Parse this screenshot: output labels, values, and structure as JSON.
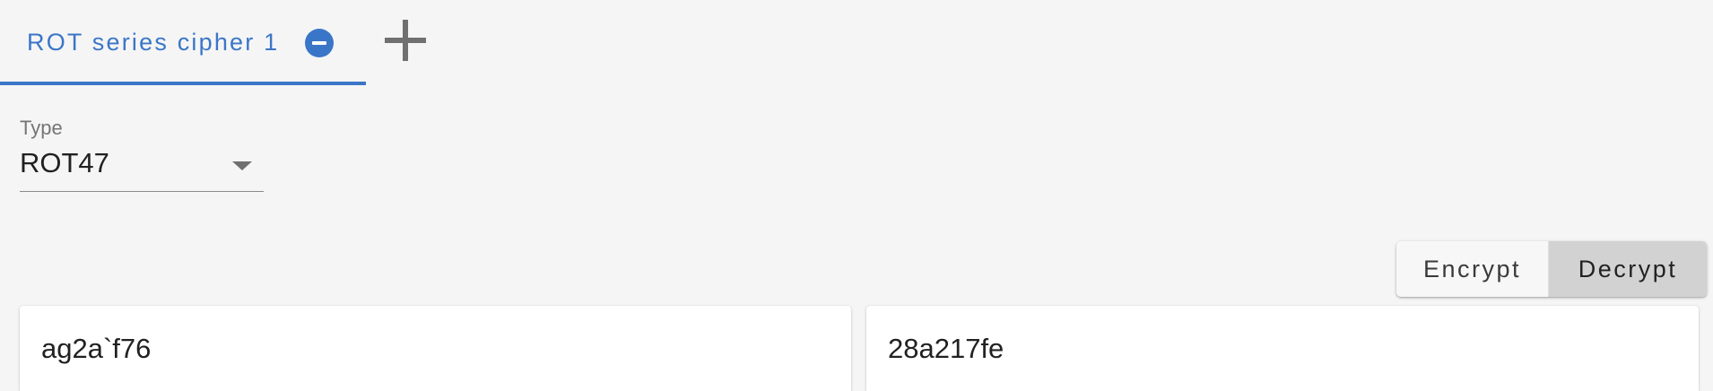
{
  "tabs": [
    {
      "label": "ROT series cipher 1",
      "active": true
    }
  ],
  "type_field": {
    "label": "Type",
    "value": "ROT47"
  },
  "mode_toggle": {
    "encrypt_label": "Encrypt",
    "decrypt_label": "Decrypt",
    "selected": "Decrypt"
  },
  "panels": {
    "input_text": "ag2a`f76",
    "output_text": "28a217fe"
  },
  "icons": {
    "tab_close": "minus-circle-icon",
    "add_tab": "plus-icon",
    "dropdown": "caret-down-icon"
  },
  "colors": {
    "accent": "#3a76c8",
    "background": "#f5f5f5",
    "selected_toggle": "#d2d2d2"
  }
}
